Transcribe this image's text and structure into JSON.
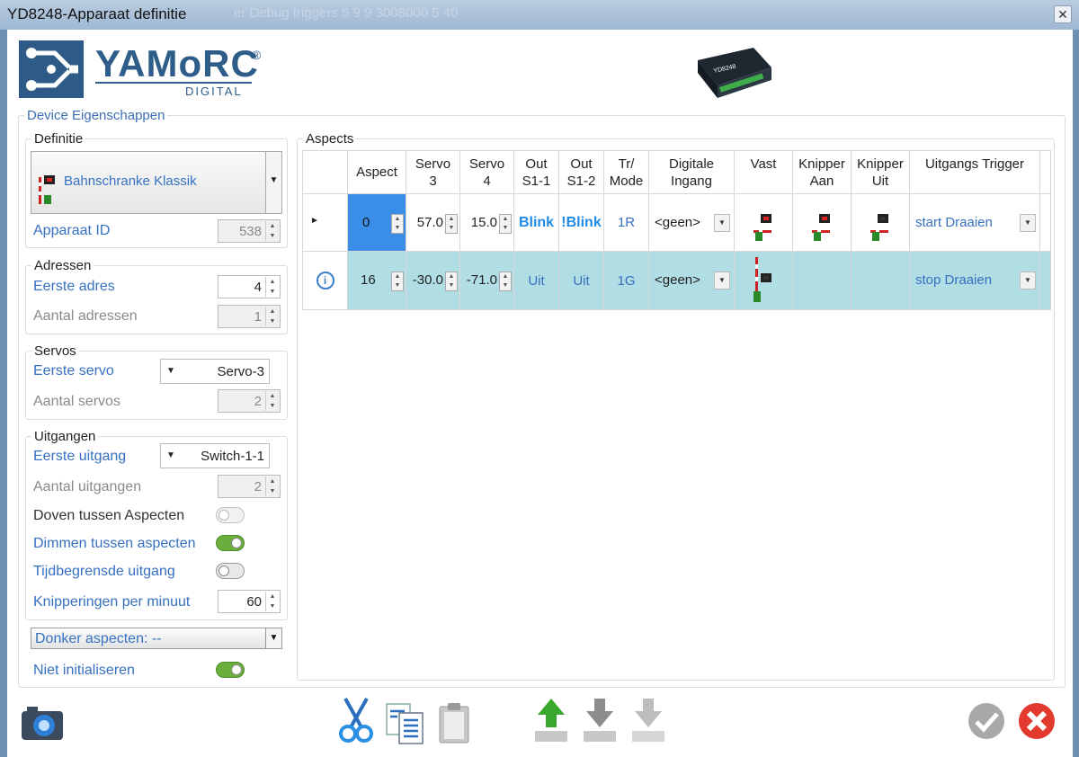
{
  "window": {
    "title": "YD8248-Apparaat definitie",
    "ghost_title": "er Debug triggers  5 9 9 3008000 5 40",
    "close_icon": "close-icon"
  },
  "logo": {
    "brand": "YAMoRC",
    "reg": "®",
    "sub": "DIGITAL"
  },
  "device_section": {
    "legend": "Device Eigenschappen",
    "definitie": {
      "legend": "Definitie",
      "value": "Bahnschranke Klassik"
    },
    "apparaat_id": {
      "label": "Apparaat ID",
      "value": "538"
    },
    "adressen": {
      "legend": "Adressen",
      "eerste_label": "Eerste adres",
      "eerste_value": "4",
      "aantal_label": "Aantal adressen",
      "aantal_value": "1"
    },
    "servos": {
      "legend": "Servos",
      "eerste_label": "Eerste servo",
      "eerste_value": "Servo-3",
      "aantal_label": "Aantal servos",
      "aantal_value": "2"
    },
    "uitgangen": {
      "legend": "Uitgangen",
      "eerste_label": "Eerste uitgang",
      "eerste_value": "Switch-1-1",
      "aantal_label": "Aantal uitgangen",
      "aantal_value": "2",
      "doven_label": "Doven tussen Aspecten",
      "doven_on": false,
      "dimmen_label": "Dimmen tussen aspecten",
      "dimmen_on": true,
      "tijd_label": "Tijdbegrensde uitgang",
      "tijd_on": false,
      "knipper_label": "Knipperingen per minuut",
      "knipper_value": "60"
    },
    "donker": "Donker aspecten: --",
    "niet_init": {
      "label": "Niet initialiseren",
      "on": true
    }
  },
  "aspects": {
    "legend": "Aspects",
    "headers": {
      "aspect": "Aspect",
      "servo3_a": "Servo",
      "servo3_b": "3",
      "servo4_a": "Servo",
      "servo4_b": "4",
      "out1_a": "Out",
      "out1_b": "S1-1",
      "out2_a": "Out",
      "out2_b": "S1-2",
      "tr_a": "Tr/",
      "tr_b": "Mode",
      "dig_a": "Digitale",
      "dig_b": "Ingang",
      "vast": "Vast",
      "kaan_a": "Knipper",
      "kaan_b": "Aan",
      "kuit_a": "Knipper",
      "kuit_b": "Uit",
      "trigger": "Uitgangs Trigger"
    },
    "rows": [
      {
        "aspect": "0",
        "servo3": "57.0",
        "servo4": "15.0",
        "out1": "Blink",
        "out2": "!Blink",
        "tr": "1R",
        "dig": "<geen>",
        "trigger": "start Draaien"
      },
      {
        "aspect": "16",
        "servo3": "-30.0",
        "servo4": "-71.0",
        "out1": "Uit",
        "out2": "Uit",
        "tr": "1G",
        "dig": "<geen>",
        "trigger": "stop Draaien"
      }
    ]
  },
  "toolbar": {
    "icons": [
      "camera-icon",
      "cut-icon",
      "copy-icon",
      "paste-icon",
      "upload-icon",
      "download-icon",
      "download-disabled-icon",
      "ok-check-icon",
      "cancel-icon"
    ]
  },
  "colors": {
    "accent": "#3670c0",
    "selected_row": "#b1dde4",
    "highlight_cell": "#3a8ee8",
    "toggle_on": "#6aaf3b",
    "cancel_red": "#e23a2e"
  }
}
